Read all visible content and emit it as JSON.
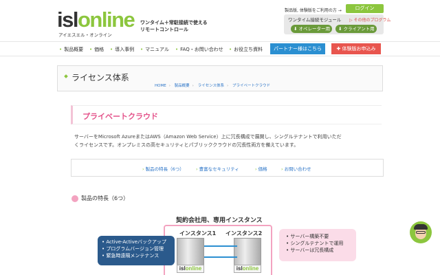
{
  "header": {
    "logo_isl": "isl",
    "logo_online": "online",
    "logo_sub": "アイエスエル・オンライン",
    "tagline_1": "ワンタイム＋常駐接続で使える",
    "tagline_2": "リモートコントロール",
    "trial_link": "製品版, 体験版をご利用の方 →",
    "login": "ログイン",
    "module_label": "ワンタイム接続モジュール",
    "other_link": "▷ その他のプログラム",
    "operator_btn": "⬇ オペレーター用",
    "client_btn": "⬇ クライアント用"
  },
  "nav": {
    "items": [
      "製品概要",
      "価格",
      "導入事例",
      "マニュアル",
      "FAQ・お問い合わせ",
      "お役立ち資料"
    ],
    "partner": "パートナー様はこちら",
    "apply": "✚ 体験版お申込み"
  },
  "page": {
    "title": "ライセンス体系",
    "breadcrumb": [
      "HOME",
      "製品概要",
      "ライセンス体系",
      "プライベートクラウド"
    ]
  },
  "section": {
    "heading": "プライベートクラウド",
    "desc_1": "サーバーをMicrosoft AzureまたはAWS（Amazon Web Service）上に冗長構成で展開し、シングルテナントで利用いただ",
    "desc_2": "くライセンスです。オンプレミスの高セキュリティとパブリッククラウドの冗長性両方を備えています。",
    "anchors": [
      "製品の特長（6つ）",
      "豊富なセキュリティ",
      "価格",
      "お問い合わせ"
    ],
    "sub_heading": "製品の特長（6つ）"
  },
  "diagram": {
    "title": "契約会社用、専用インスタンス",
    "instance_1": "インスタンス1",
    "instance_2": "インスタンス2",
    "logo_isl": "isl",
    "logo_online": "online",
    "left_items": [
      "Active-Activeバックアップ",
      "プログラムバージョン管理",
      "緊急時遠隔メンテナンス"
    ],
    "right_items": [
      "サーバー構築不要",
      "シングルテナントで運用",
      "サーバーは冗長構成"
    ]
  },
  "colors": {
    "brand_green": "#8cc63e",
    "partner_blue": "#2b8fd1",
    "apply_red": "#e8554e",
    "pink_accent": "#e4528a"
  }
}
